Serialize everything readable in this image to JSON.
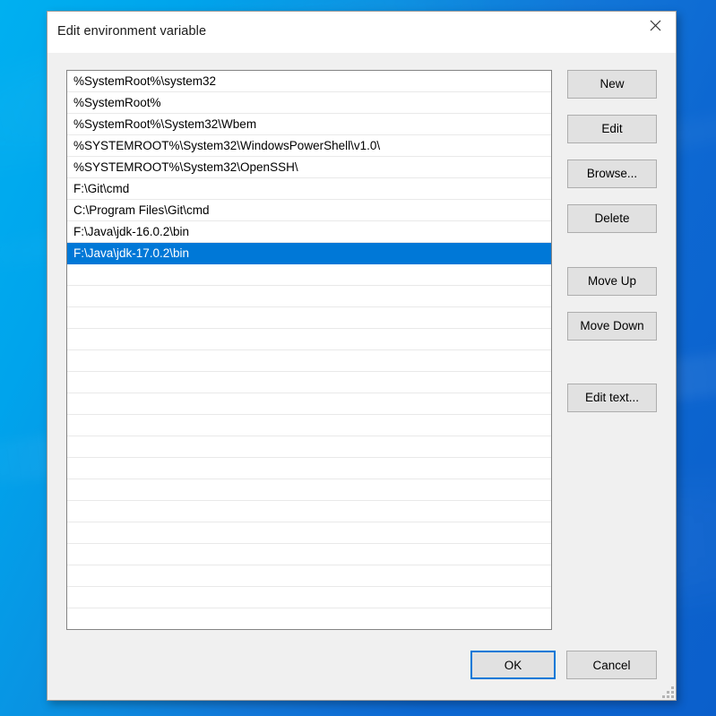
{
  "window": {
    "title": "Edit environment variable",
    "close_icon": "close-icon"
  },
  "colors": {
    "selection": "#0078d7",
    "focus_border": "#0078d7",
    "button_face": "#e1e1e1",
    "button_border": "#adadad",
    "dialog_face": "#f0f0f0",
    "listbox_background": "#ffffff",
    "listbox_border": "#848484",
    "row_separator": "#e9e9e9",
    "desktop_blue": "#0b6fd4"
  },
  "list": {
    "selected_index": 8,
    "total_visible_rows": 26,
    "entries": [
      "%SystemRoot%\\system32",
      "%SystemRoot%",
      "%SystemRoot%\\System32\\Wbem",
      "%SYSTEMROOT%\\System32\\WindowsPowerShell\\v1.0\\",
      "%SYSTEMROOT%\\System32\\OpenSSH\\",
      "F:\\Git\\cmd",
      "C:\\Program Files\\Git\\cmd",
      "F:\\Java\\jdk-16.0.2\\bin",
      "F:\\Java\\jdk-17.0.2\\bin"
    ]
  },
  "side_buttons": {
    "new": "New",
    "edit": "Edit",
    "browse": "Browse...",
    "delete": "Delete",
    "move_up": "Move Up",
    "move_down": "Move Down",
    "edit_text": "Edit text..."
  },
  "footer": {
    "ok": "OK",
    "cancel": "Cancel"
  }
}
